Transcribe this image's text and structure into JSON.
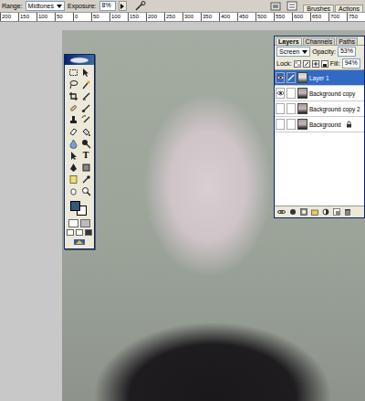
{
  "options_bar": {
    "range_label": "Range:",
    "range_value": "Midtones",
    "exposure_label": "Exposure:",
    "exposure_value": "8%"
  },
  "palette_well": {
    "tabs": [
      "Brushes",
      "Actions"
    ]
  },
  "ruler": {
    "ticks": [
      "200",
      "150",
      "100",
      "50",
      "0",
      "50",
      "100",
      "150",
      "200",
      "250",
      "300",
      "350",
      "400",
      "450",
      "500",
      "550",
      "600",
      "650",
      "700",
      "750"
    ]
  },
  "toolbox": {
    "type_tool": "T",
    "foreground_color": "#2f5a7c",
    "background_color": "#ffffff"
  },
  "layers_panel": {
    "tabs": [
      {
        "label": "Layers",
        "selected": true
      },
      {
        "label": "Channels",
        "selected": false
      },
      {
        "label": "Paths",
        "selected": false
      }
    ],
    "blend_mode": "Screen",
    "opacity_label": "Opacity:",
    "opacity": "53%",
    "lock_label": "Lock:",
    "fill_label": "Fill:",
    "fill": "94%",
    "layers": [
      {
        "name": "Layer 1",
        "visible": true,
        "selected": true,
        "locked": false
      },
      {
        "name": "Background copy",
        "visible": true,
        "selected": false,
        "locked": false
      },
      {
        "name": "Background copy 2",
        "visible": false,
        "selected": false,
        "locked": false
      },
      {
        "name": "Background",
        "visible": false,
        "selected": false,
        "locked": true
      }
    ]
  }
}
